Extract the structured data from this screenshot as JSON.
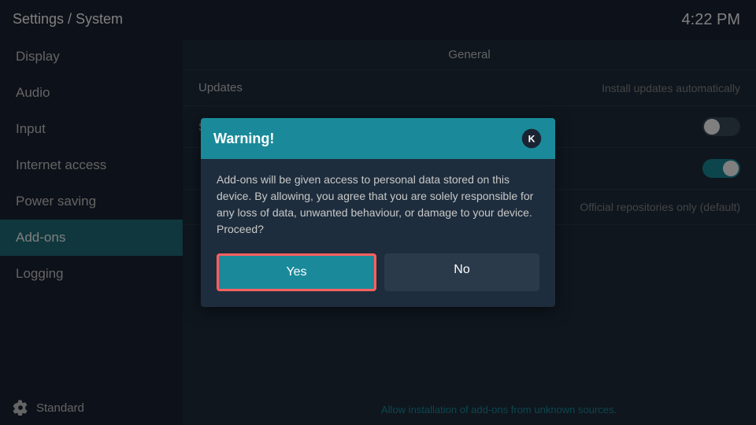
{
  "sidebar": {
    "title": "Settings / System",
    "items": [
      {
        "id": "display",
        "label": "Display",
        "active": false
      },
      {
        "id": "audio",
        "label": "Audio",
        "active": false
      },
      {
        "id": "input",
        "label": "Input",
        "active": false
      },
      {
        "id": "internet-access",
        "label": "Internet access",
        "active": false
      },
      {
        "id": "power-saving",
        "label": "Power saving",
        "active": false
      },
      {
        "id": "add-ons",
        "label": "Add-ons",
        "active": true
      },
      {
        "id": "logging",
        "label": "Logging",
        "active": false
      }
    ],
    "footer_label": "Standard"
  },
  "header": {
    "time": "4:22 PM"
  },
  "main": {
    "section_label": "General",
    "rows": [
      {
        "id": "updates",
        "label": "Updates",
        "value": "Install updates automatically",
        "type": "text"
      },
      {
        "id": "show-notifications",
        "label": "Show notifications",
        "value": "",
        "type": "toggle-off"
      },
      {
        "id": "unknown-sources",
        "label": "",
        "value": "",
        "type": "toggle-on"
      },
      {
        "id": "repositories",
        "label": "",
        "value": "Official repositories only (default)",
        "type": "text"
      }
    ],
    "footer_note": "Allow installation of add-ons from unknown sources."
  },
  "dialog": {
    "title": "Warning!",
    "message": "Add-ons will be given access to personal data stored on this device. By allowing, you agree that you are solely responsible for any loss of data, unwanted behaviour, or damage to your device. Proceed?",
    "btn_yes": "Yes",
    "btn_no": "No"
  }
}
